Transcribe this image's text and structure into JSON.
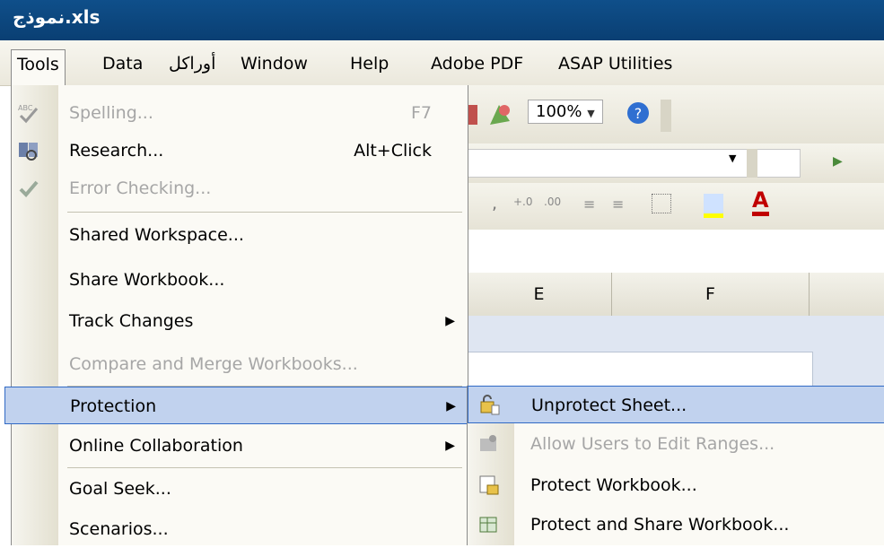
{
  "window": {
    "title": "نموذج.xls"
  },
  "menubar": {
    "items": [
      {
        "label": "Tools"
      },
      {
        "label": "Data"
      },
      {
        "label": "أوراكل"
      },
      {
        "label": "Window"
      },
      {
        "label": "Help"
      },
      {
        "label": "Adobe PDF"
      },
      {
        "label": "ASAP Utilities"
      }
    ]
  },
  "toolbar": {
    "zoom": "100%",
    "col_headers": [
      "E",
      "F"
    ]
  },
  "tools_menu": {
    "items": [
      {
        "label": "Spelling...",
        "shortcut": "F7",
        "enabled": false,
        "icon": "spelling-icon"
      },
      {
        "label": "Research...",
        "shortcut": "Alt+Click",
        "enabled": true,
        "icon": "research-icon"
      },
      {
        "label": "Error Checking...",
        "enabled": false,
        "icon": "error-checking-icon"
      },
      {
        "label": "Shared Workspace...",
        "enabled": true
      },
      {
        "label": "Share Workbook...",
        "enabled": true
      },
      {
        "label": "Track Changes",
        "enabled": true,
        "submenu": true
      },
      {
        "label": "Compare and Merge Workbooks...",
        "enabled": false
      },
      {
        "label": "Protection",
        "enabled": true,
        "submenu": true,
        "highlighted": true
      },
      {
        "label": "Online Collaboration",
        "enabled": true,
        "submenu": true
      },
      {
        "label": "Goal Seek...",
        "enabled": true
      },
      {
        "label": "Scenarios...",
        "enabled": true
      }
    ]
  },
  "protection_submenu": {
    "items": [
      {
        "label": "Unprotect Sheet...",
        "enabled": true,
        "highlighted": true,
        "icon": "unprotect-sheet-icon"
      },
      {
        "label": "Allow Users to Edit Ranges...",
        "enabled": false,
        "icon": "allow-users-icon"
      },
      {
        "label": "Protect Workbook...",
        "enabled": true,
        "icon": "protect-workbook-icon"
      },
      {
        "label": "Protect and Share Workbook...",
        "enabled": true,
        "icon": "protect-share-icon"
      }
    ]
  },
  "colors": {
    "title_bar": "#0f4f8a",
    "highlight": "#c1d2ee",
    "highlight_border": "#316ac5",
    "disabled_text": "#a6a6a6"
  }
}
